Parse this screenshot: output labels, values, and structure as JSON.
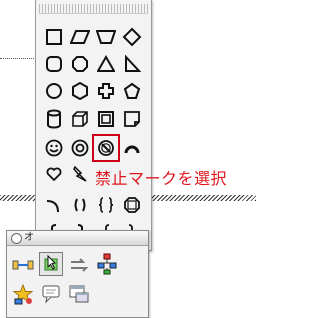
{
  "palette": {
    "rows": [
      [
        "square-icon",
        "parallelogram-icon",
        "trapezoid-icon",
        "diamond-icon"
      ],
      [
        "rounded-square-icon",
        "octagon-icon",
        "triangle-icon",
        "right-triangle-icon"
      ],
      [
        "circle-icon",
        "hexagon-icon",
        "cross-icon",
        "pentagon-icon"
      ],
      [
        "cylinder-icon",
        "cube-icon",
        "frame-icon",
        "folded-corner-icon"
      ],
      [
        "smiley-icon",
        "donut-icon",
        "no-symbol-icon",
        "arc-icon"
      ],
      [
        "heart-icon",
        "lightning-icon"
      ],
      [
        "arc-bracket-icon",
        "double-bracket-icon",
        "double-brace-icon",
        "bevel-icon"
      ],
      [
        "left-bracket-icon",
        "right-bracket-icon",
        "left-brace-icon",
        "right-brace-icon"
      ]
    ],
    "selected": "no-symbol-icon"
  },
  "annotation": {
    "text": "禁止マークを選択",
    "color": "#e0161d"
  },
  "tool_window": {
    "title": "オ",
    "tools": [
      "connector-icon",
      "select-shape-icon",
      "arrows-icon",
      "flowchart-icon",
      "star-shape-icon",
      "callout-shape-icon",
      "window-shapes-icon"
    ],
    "active": "select-shape-icon"
  }
}
